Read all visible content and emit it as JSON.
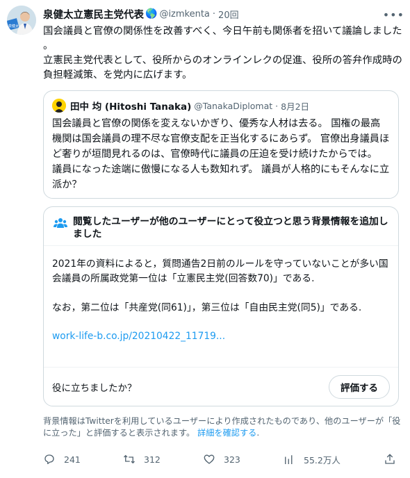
{
  "tweet": {
    "author_name": "泉健太立憲民主党代表",
    "author_emoji": "🌎",
    "handle": "@izmkenta",
    "separator": "·",
    "time": "20回",
    "text": "国会議員と官僚の関係性を改善すべく、今日午前も関係者を招いて議論しました 。\n立憲民主党代表として、役所からのオンラインレクの促進、役所の答弁作成時の負担軽減策、を党内に広げます。",
    "avatar_sign_text": "泉健太"
  },
  "quote": {
    "name": "田中 均 (Hitoshi Tanaka)",
    "handle": "@TanakaDiplomat",
    "separator": "·",
    "time": "8月2日",
    "text": "国会議員と官僚の関係を変えないかぎり、優秀な人材は去る。 国権の最高機関は国会議員の理不尽な官僚支配を正当化するにあらず。 官僚出身議員ほど奢りが垣間見れるのは、官僚時代に議員の圧迫を受け続けたからでは。 議員になった途端に傲慢になる人も数知れず。 議員が人格的にもそんなに立派か？"
  },
  "note": {
    "title": "閲覧したユーザーが他のユーザーにとって役立つと思う背景情報を追加しました",
    "paragraph1": "2021年の資料によると，質問通告2日前のルールを守っていないことが多い国会議員の所属政党第一位は「立憲民主党(回答数70)」である.",
    "paragraph2": "なお，第二位は「共産党(同61)」，第三位は「自由民主党(同5)」である.",
    "link": "work-life-b.co.jp/20210422_11719...",
    "question": "役に立ちましたか？",
    "rate_button": "評価する"
  },
  "disclaimer": {
    "text": "背景情報はTwitterを利用しているユーザーにより作成されたものであり、他のユーザーが「役に立った」と評価すると表示されます。",
    "link": "詳細を確認する",
    "end": "."
  },
  "actions": {
    "replies": "241",
    "retweets": "312",
    "likes": "323",
    "views": "55.2万人"
  },
  "icons": {
    "more": "more-icon",
    "reply": "reply-icon",
    "retweet": "retweet-icon",
    "like": "heart-icon",
    "views": "views-icon",
    "share": "share-icon"
  },
  "colors": {
    "link": "#1d9bf0",
    "muted": "#536471",
    "border": "#cfd9de",
    "quote_avatar": "#ffd400"
  }
}
